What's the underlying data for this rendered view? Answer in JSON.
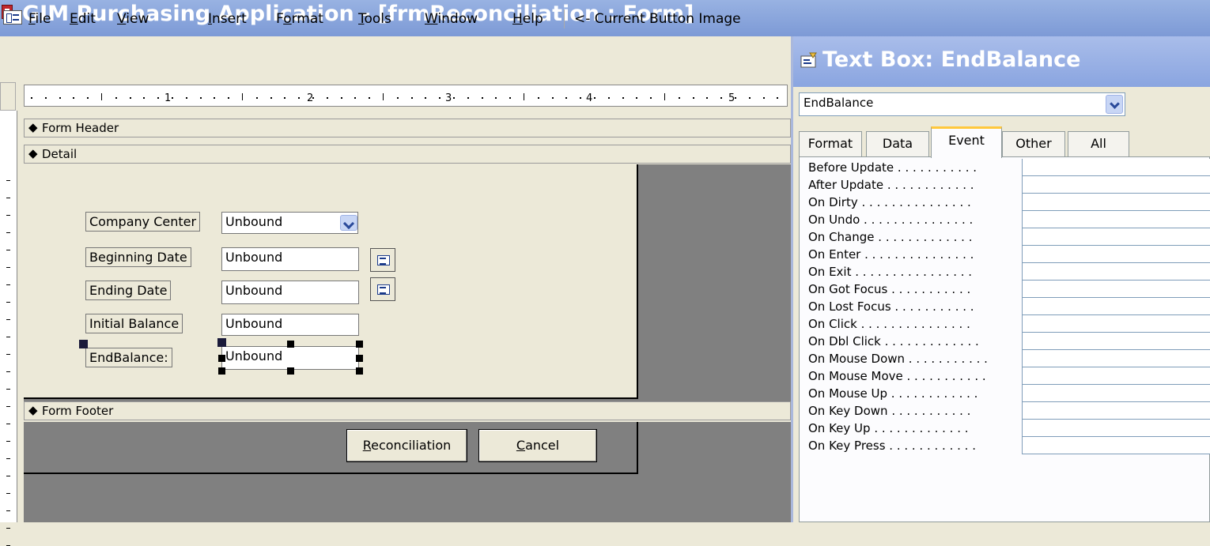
{
  "window": {
    "title": "GIM Purchasing Application - [frmReconciliation : Form]"
  },
  "menu": {
    "items": [
      {
        "pre": "",
        "key": "F",
        "post": "ile"
      },
      {
        "pre": "",
        "key": "E",
        "post": "dit"
      },
      {
        "pre": "",
        "key": "V",
        "post": "iew"
      },
      {
        "pre": "",
        "key": "I",
        "post": "nsert"
      },
      {
        "pre": "F",
        "key": "o",
        "post": "rmat"
      },
      {
        "pre": "",
        "key": "T",
        "post": "ools"
      },
      {
        "pre": "",
        "key": "W",
        "post": "indow"
      },
      {
        "pre": "",
        "key": "H",
        "post": "elp"
      }
    ],
    "current_button_text": "<- Current Button Image"
  },
  "ruler": {
    "numbers": [
      "1",
      "2",
      "3",
      "4",
      "5"
    ]
  },
  "sections": {
    "form_header": "Form Header",
    "detail": "Detail",
    "form_footer": "Form Footer"
  },
  "form": {
    "fields": [
      {
        "label": "Company Center",
        "value": "Unbound"
      },
      {
        "label": "Beginning Date",
        "value": "Unbound"
      },
      {
        "label": "Ending Date",
        "value": "Unbound"
      },
      {
        "label": "Initial Balance",
        "value": "Unbound"
      },
      {
        "label": "EndBalance:",
        "value": "Unbound"
      }
    ],
    "buttons": {
      "reconciliation": {
        "key": "R",
        "rest": "econciliation"
      },
      "cancel": {
        "key": "C",
        "rest": "ancel"
      }
    }
  },
  "properties": {
    "title": "Text Box: EndBalance",
    "selected_object": "EndBalance",
    "tabs": [
      "Format",
      "Data",
      "Event",
      "Other",
      "All"
    ],
    "active_tab": "Event",
    "rows": [
      {
        "name": "Before Update . . . . . . . . . . .",
        "value": ""
      },
      {
        "name": "After Update . . . . . . . . . . . .",
        "value": ""
      },
      {
        "name": "On Dirty . . . . . . . . . . . . . . .",
        "value": ""
      },
      {
        "name": "On Undo . . . . . . . . . . . . . . .",
        "value": ""
      },
      {
        "name": "On Change . . . . . . . . . . . . .",
        "value": ""
      },
      {
        "name": "On Enter . . . . . . . . . . . . . . .",
        "value": ""
      },
      {
        "name": "On Exit . . . . . . . . . . . . . . . .",
        "value": ""
      },
      {
        "name": "On Got Focus . . . . . . . . . . .",
        "value": ""
      },
      {
        "name": "On Lost Focus . . . . . . . . . . .",
        "value": ""
      },
      {
        "name": "On Click . . . . . . . . . . . . . . .",
        "value": ""
      },
      {
        "name": "On Dbl Click . . . . . . . . . . . . .",
        "value": ""
      },
      {
        "name": "On Mouse Down . . . . . . . . . . .",
        "value": ""
      },
      {
        "name": "On Mouse Move . . . . . . . . . . .",
        "value": ""
      },
      {
        "name": "On Mouse Up . . . . . . . . . . . .",
        "value": ""
      },
      {
        "name": "On Key Down . . . . . . . . . . .",
        "value": ""
      },
      {
        "name": "On Key Up . . . . . . . . . . . . .",
        "value": ""
      },
      {
        "name": "On Key Press . . . . . . . . . . . .",
        "value": ""
      }
    ]
  }
}
